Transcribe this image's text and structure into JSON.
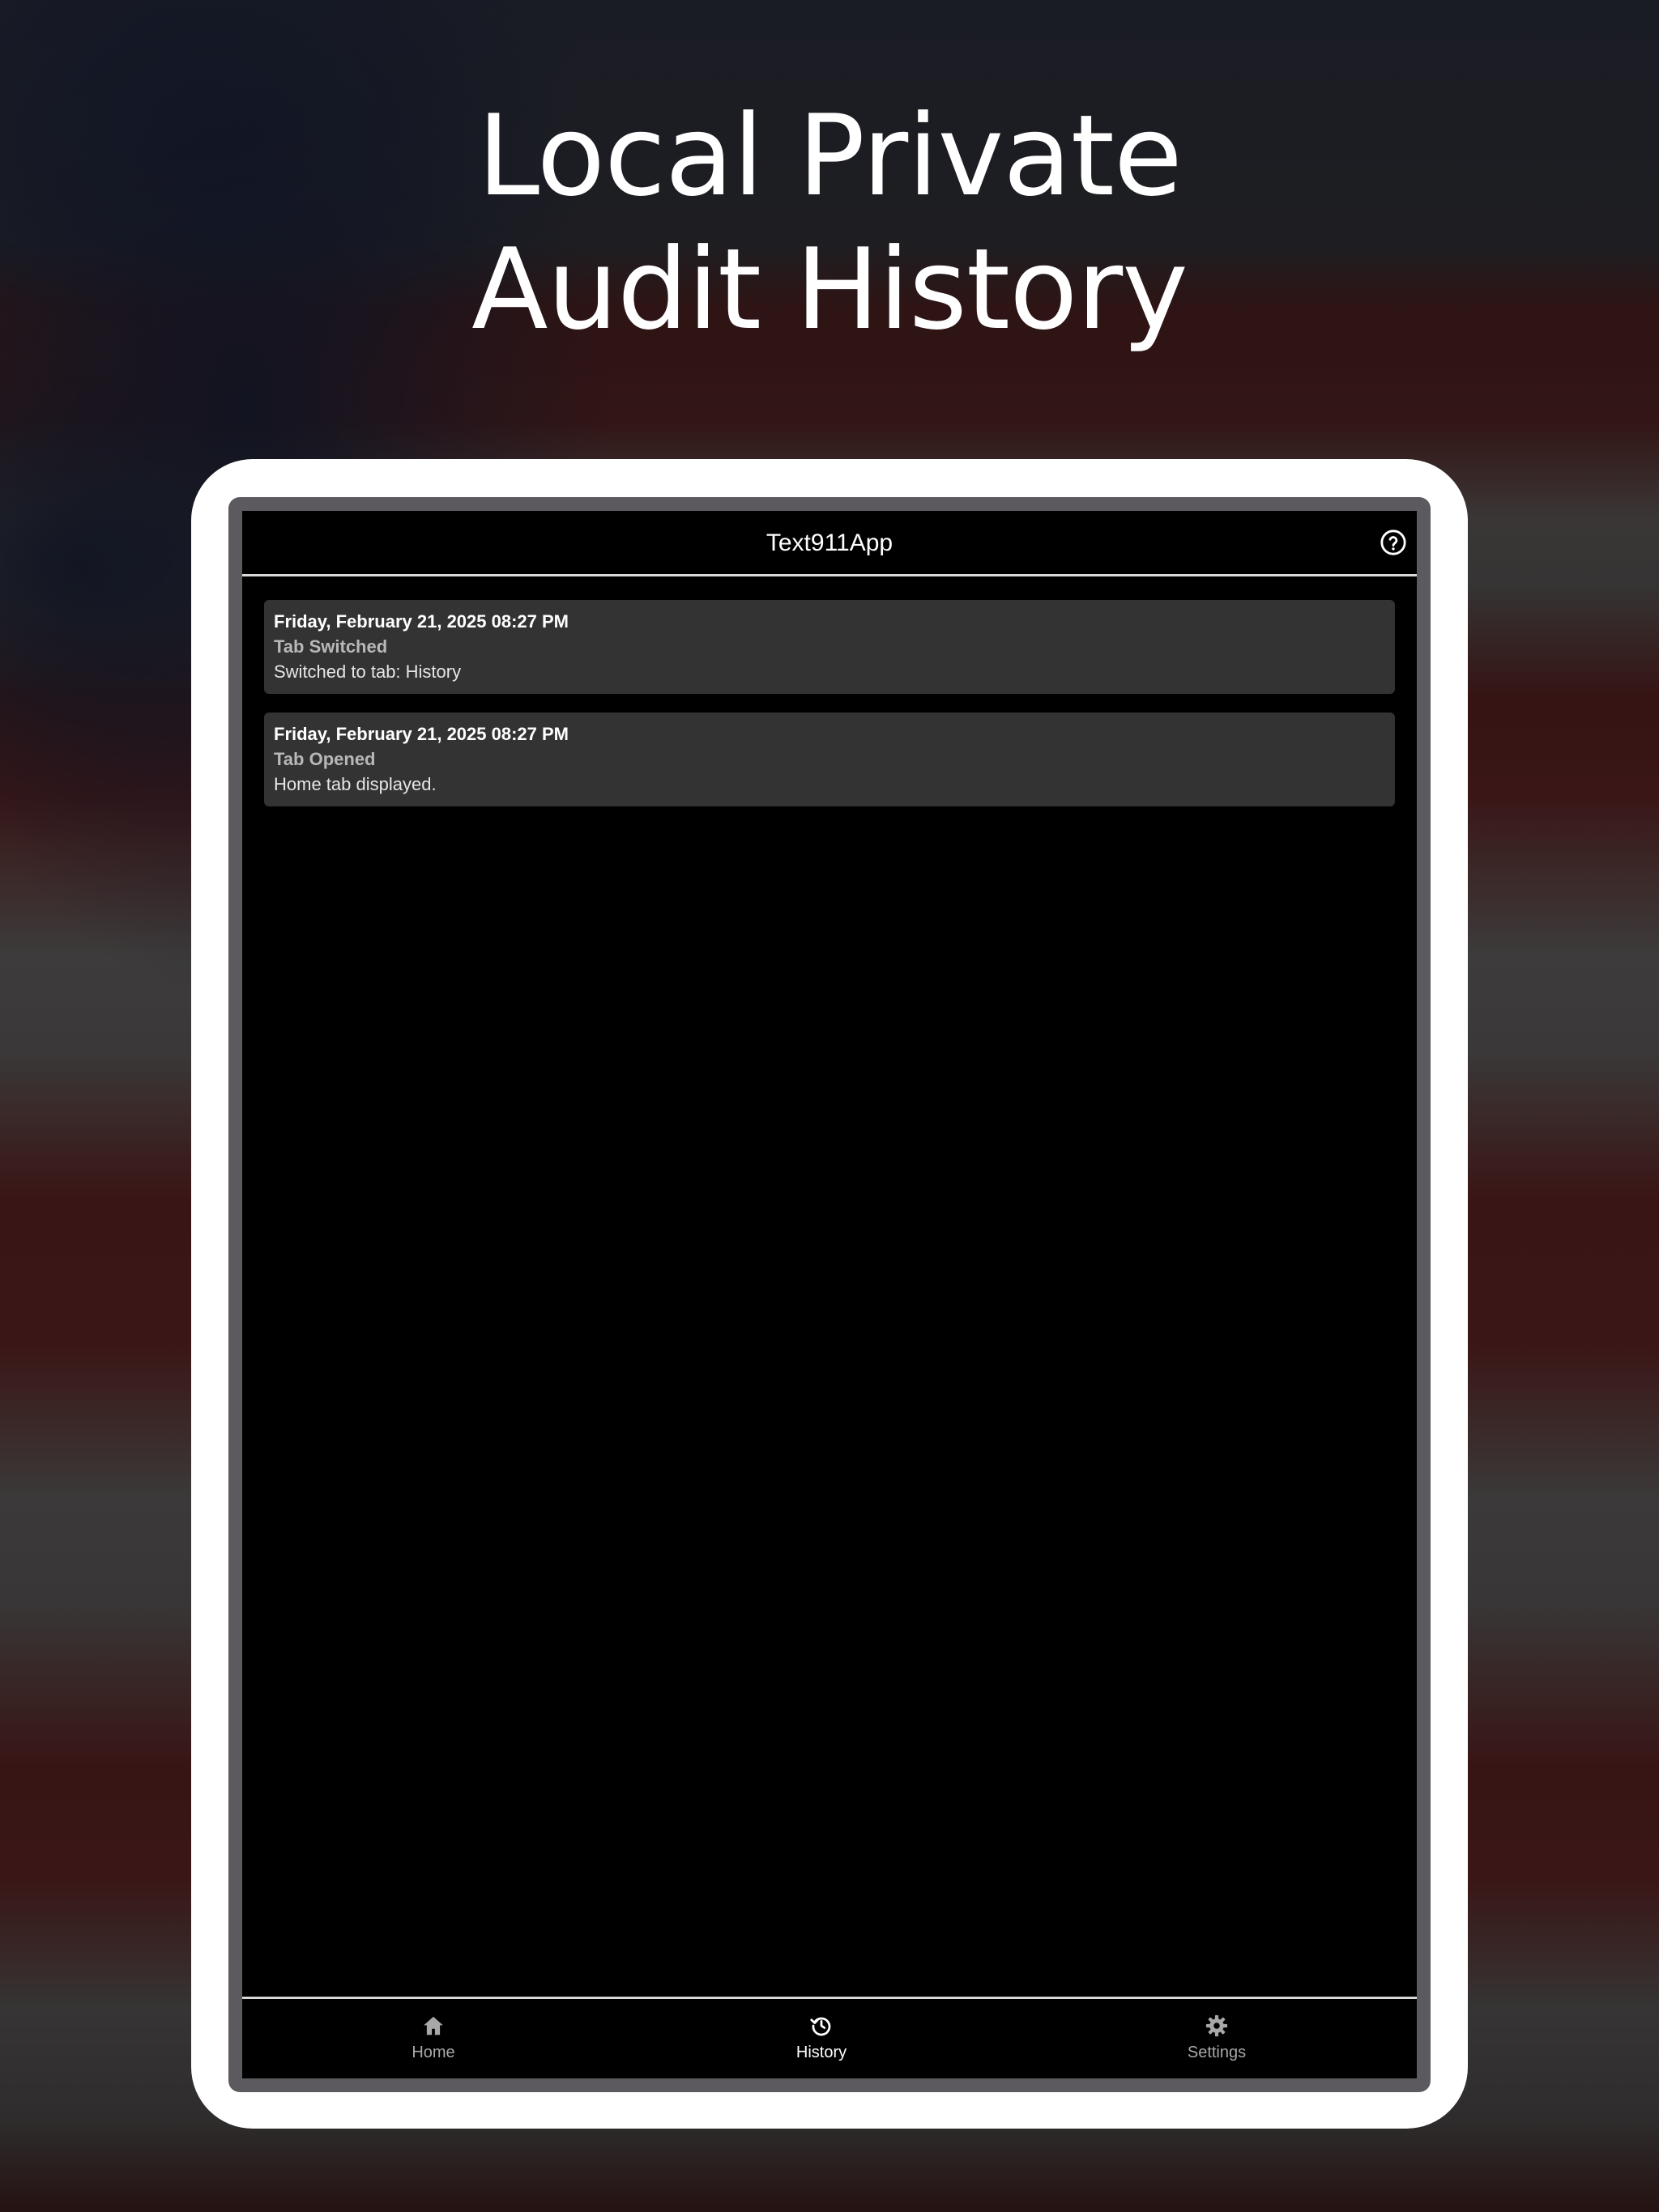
{
  "headline": {
    "line1": "Local Private",
    "line2": "Audit History"
  },
  "app": {
    "title": "Text911App",
    "help_icon": "help-circle-icon"
  },
  "history": {
    "entries": [
      {
        "date": "Friday, February 21, 2025 08:27 PM",
        "type": "Tab Switched",
        "detail": "Switched to tab: History"
      },
      {
        "date": "Friday, February 21, 2025 08:27 PM",
        "type": "Tab Opened",
        "detail": "Home tab displayed."
      }
    ]
  },
  "nav": {
    "items": [
      {
        "label": "Home",
        "icon": "home-icon",
        "active": false
      },
      {
        "label": "History",
        "icon": "history-icon",
        "active": true
      },
      {
        "label": "Settings",
        "icon": "gear-icon",
        "active": false
      }
    ]
  },
  "colors": {
    "screen_bg": "#000000",
    "card_bg": "#333333",
    "active_nav": "#ffffff",
    "inactive_nav": "#a8a8a8"
  }
}
